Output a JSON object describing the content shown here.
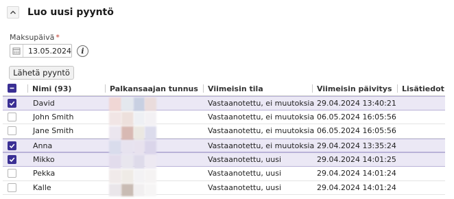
{
  "panel": {
    "title": "Luo uusi pyyntö"
  },
  "payment_date": {
    "label": "Maksupäivä",
    "required_mark": "*",
    "value": "13.05.2024"
  },
  "send_button": {
    "label": "Lähetä pyyntö"
  },
  "table": {
    "columns": [
      "Nimi (93)",
      "Palkansaajan tunnus",
      "Viimeisin tila",
      "Viimeisin päivitys",
      "Lisätiedot"
    ],
    "rows": [
      {
        "checked": true,
        "name": "David",
        "status": "Vastaanotettu, ei muutoksia",
        "updated": "29.04.2024 13:40:21",
        "info": ""
      },
      {
        "checked": false,
        "name": "John Smith",
        "status": "Vastaanotettu, ei muutoksia",
        "updated": "06.05.2024 16:05:56",
        "info": ""
      },
      {
        "checked": false,
        "name": "Jane Smith",
        "status": "Vastaanotettu, ei muutoksia",
        "updated": "06.05.2024 16:05:56",
        "info": ""
      },
      {
        "checked": true,
        "name": "Anna",
        "status": "Vastaanotettu, ei muutoksia",
        "updated": "29.04.2024 13:35:24",
        "info": ""
      },
      {
        "checked": true,
        "name": "Mikko",
        "status": "Vastaanotettu, uusi",
        "updated": "29.04.2024 14:01:25",
        "info": ""
      },
      {
        "checked": false,
        "name": "Pekka",
        "status": "Vastaanotettu, uusi",
        "updated": "29.04.2024 14:01:24",
        "info": ""
      },
      {
        "checked": false,
        "name": "Kalle",
        "status": "Vastaanotettu, uusi",
        "updated": "29.04.2024 14:01:24",
        "info": ""
      }
    ]
  },
  "colors": {
    "accent": "#3a2f94",
    "selected_row": "#ebe8f5"
  }
}
